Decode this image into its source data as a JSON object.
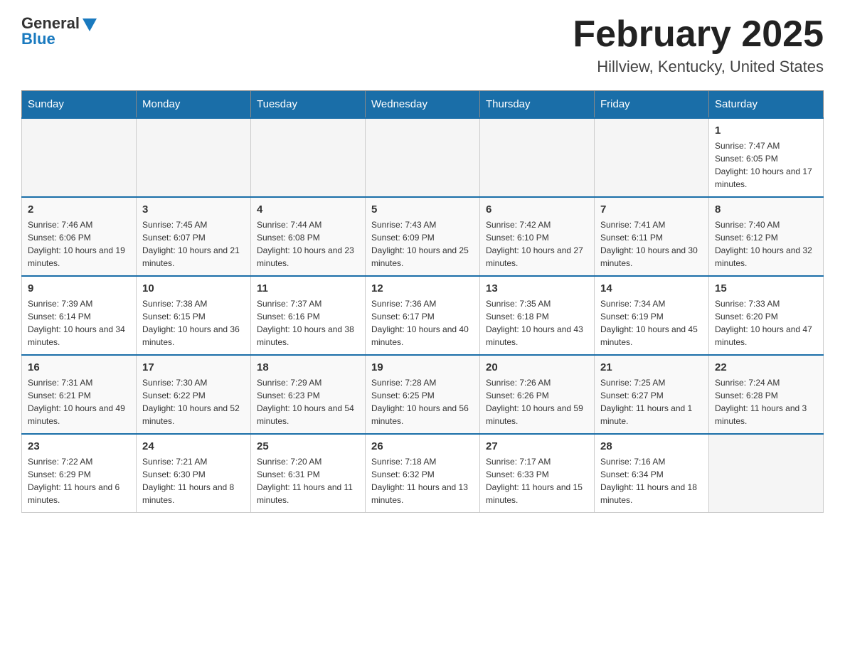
{
  "header": {
    "logo_general": "General",
    "logo_blue": "Blue",
    "month_title": "February 2025",
    "location": "Hillview, Kentucky, United States"
  },
  "days_of_week": [
    "Sunday",
    "Monday",
    "Tuesday",
    "Wednesday",
    "Thursday",
    "Friday",
    "Saturday"
  ],
  "weeks": [
    [
      {
        "day": "",
        "info": ""
      },
      {
        "day": "",
        "info": ""
      },
      {
        "day": "",
        "info": ""
      },
      {
        "day": "",
        "info": ""
      },
      {
        "day": "",
        "info": ""
      },
      {
        "day": "",
        "info": ""
      },
      {
        "day": "1",
        "info": "Sunrise: 7:47 AM\nSunset: 6:05 PM\nDaylight: 10 hours and 17 minutes."
      }
    ],
    [
      {
        "day": "2",
        "info": "Sunrise: 7:46 AM\nSunset: 6:06 PM\nDaylight: 10 hours and 19 minutes."
      },
      {
        "day": "3",
        "info": "Sunrise: 7:45 AM\nSunset: 6:07 PM\nDaylight: 10 hours and 21 minutes."
      },
      {
        "day": "4",
        "info": "Sunrise: 7:44 AM\nSunset: 6:08 PM\nDaylight: 10 hours and 23 minutes."
      },
      {
        "day": "5",
        "info": "Sunrise: 7:43 AM\nSunset: 6:09 PM\nDaylight: 10 hours and 25 minutes."
      },
      {
        "day": "6",
        "info": "Sunrise: 7:42 AM\nSunset: 6:10 PM\nDaylight: 10 hours and 27 minutes."
      },
      {
        "day": "7",
        "info": "Sunrise: 7:41 AM\nSunset: 6:11 PM\nDaylight: 10 hours and 30 minutes."
      },
      {
        "day": "8",
        "info": "Sunrise: 7:40 AM\nSunset: 6:12 PM\nDaylight: 10 hours and 32 minutes."
      }
    ],
    [
      {
        "day": "9",
        "info": "Sunrise: 7:39 AM\nSunset: 6:14 PM\nDaylight: 10 hours and 34 minutes."
      },
      {
        "day": "10",
        "info": "Sunrise: 7:38 AM\nSunset: 6:15 PM\nDaylight: 10 hours and 36 minutes."
      },
      {
        "day": "11",
        "info": "Sunrise: 7:37 AM\nSunset: 6:16 PM\nDaylight: 10 hours and 38 minutes."
      },
      {
        "day": "12",
        "info": "Sunrise: 7:36 AM\nSunset: 6:17 PM\nDaylight: 10 hours and 40 minutes."
      },
      {
        "day": "13",
        "info": "Sunrise: 7:35 AM\nSunset: 6:18 PM\nDaylight: 10 hours and 43 minutes."
      },
      {
        "day": "14",
        "info": "Sunrise: 7:34 AM\nSunset: 6:19 PM\nDaylight: 10 hours and 45 minutes."
      },
      {
        "day": "15",
        "info": "Sunrise: 7:33 AM\nSunset: 6:20 PM\nDaylight: 10 hours and 47 minutes."
      }
    ],
    [
      {
        "day": "16",
        "info": "Sunrise: 7:31 AM\nSunset: 6:21 PM\nDaylight: 10 hours and 49 minutes."
      },
      {
        "day": "17",
        "info": "Sunrise: 7:30 AM\nSunset: 6:22 PM\nDaylight: 10 hours and 52 minutes."
      },
      {
        "day": "18",
        "info": "Sunrise: 7:29 AM\nSunset: 6:23 PM\nDaylight: 10 hours and 54 minutes."
      },
      {
        "day": "19",
        "info": "Sunrise: 7:28 AM\nSunset: 6:25 PM\nDaylight: 10 hours and 56 minutes."
      },
      {
        "day": "20",
        "info": "Sunrise: 7:26 AM\nSunset: 6:26 PM\nDaylight: 10 hours and 59 minutes."
      },
      {
        "day": "21",
        "info": "Sunrise: 7:25 AM\nSunset: 6:27 PM\nDaylight: 11 hours and 1 minute."
      },
      {
        "day": "22",
        "info": "Sunrise: 7:24 AM\nSunset: 6:28 PM\nDaylight: 11 hours and 3 minutes."
      }
    ],
    [
      {
        "day": "23",
        "info": "Sunrise: 7:22 AM\nSunset: 6:29 PM\nDaylight: 11 hours and 6 minutes."
      },
      {
        "day": "24",
        "info": "Sunrise: 7:21 AM\nSunset: 6:30 PM\nDaylight: 11 hours and 8 minutes."
      },
      {
        "day": "25",
        "info": "Sunrise: 7:20 AM\nSunset: 6:31 PM\nDaylight: 11 hours and 11 minutes."
      },
      {
        "day": "26",
        "info": "Sunrise: 7:18 AM\nSunset: 6:32 PM\nDaylight: 11 hours and 13 minutes."
      },
      {
        "day": "27",
        "info": "Sunrise: 7:17 AM\nSunset: 6:33 PM\nDaylight: 11 hours and 15 minutes."
      },
      {
        "day": "28",
        "info": "Sunrise: 7:16 AM\nSunset: 6:34 PM\nDaylight: 11 hours and 18 minutes."
      },
      {
        "day": "",
        "info": ""
      }
    ]
  ]
}
